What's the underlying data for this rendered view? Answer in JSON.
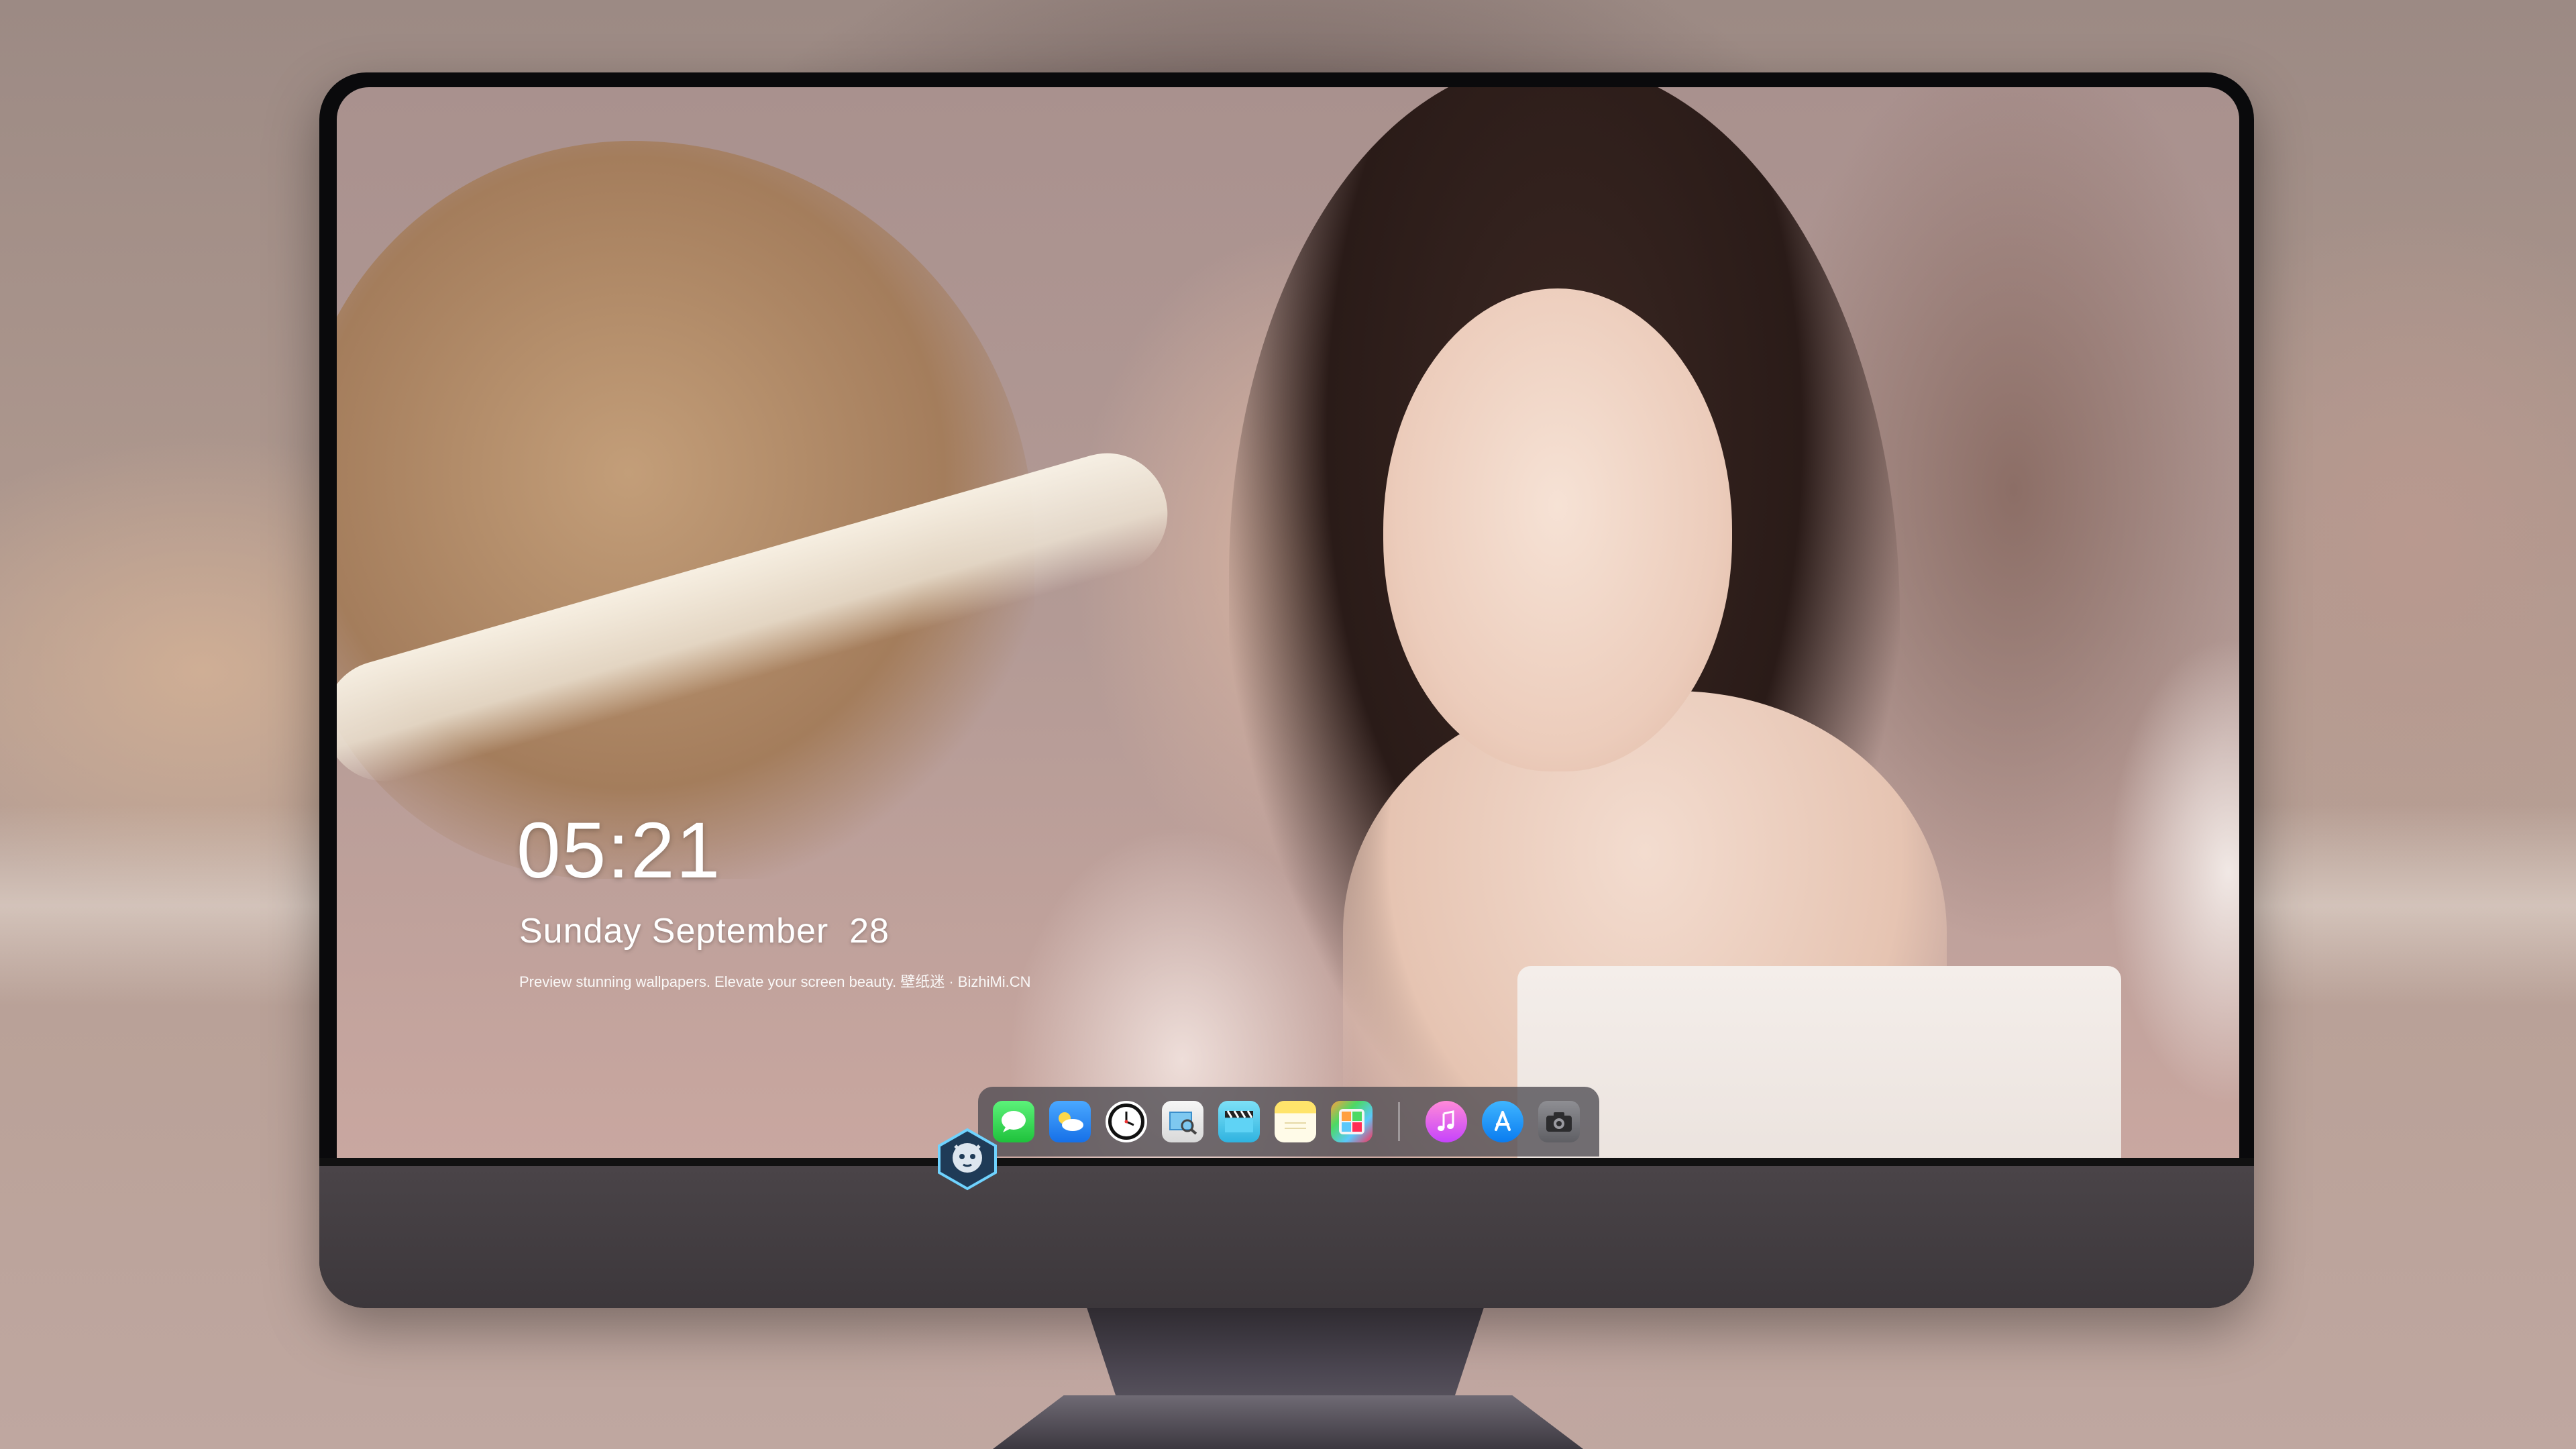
{
  "lock_screen": {
    "time": "05:21",
    "date": "Sunday September  28",
    "caption": "Preview stunning wallpapers. Elevate your screen beauty. 壁纸迷 · BizhiMi.CN"
  },
  "dock": {
    "apps": [
      {
        "name": "Messages",
        "icon": "messages-icon"
      },
      {
        "name": "Weather",
        "icon": "weather-icon"
      },
      {
        "name": "Clock",
        "icon": "clock-icon"
      },
      {
        "name": "Preview",
        "icon": "preview-icon"
      },
      {
        "name": "Clips",
        "icon": "clips-icon"
      },
      {
        "name": "Notes",
        "icon": "notes-icon"
      },
      {
        "name": "Photos",
        "icon": "photos-icon"
      },
      {
        "name": "Music",
        "icon": "music-icon"
      },
      {
        "name": "App Store",
        "icon": "app-store-icon"
      },
      {
        "name": "Camera",
        "icon": "camera-icon"
      }
    ]
  },
  "colors": {
    "monitor_bezel": "#0a0a0c",
    "monitor_chin": "#453f44",
    "dock_background": "#4e4c52",
    "text": "#ffffff"
  }
}
